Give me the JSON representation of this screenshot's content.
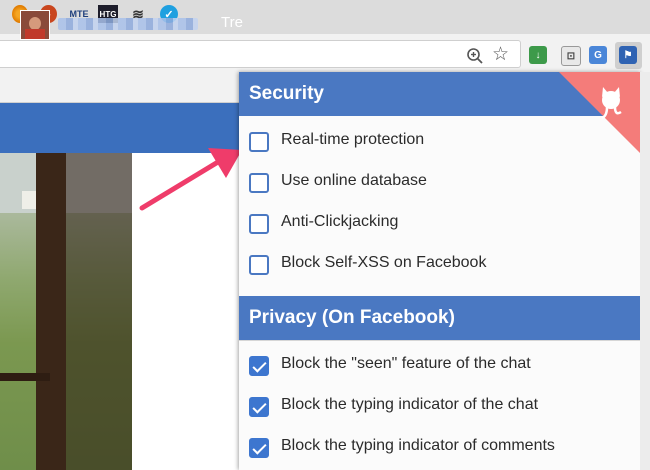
{
  "popup": {
    "security_header": "Security",
    "security_options": [
      {
        "label": "Real-time protection",
        "checked": false
      },
      {
        "label": "Use online database",
        "checked": false
      },
      {
        "label": "Anti-Clickjacking",
        "checked": false
      },
      {
        "label": "Block Self-XSS on Facebook",
        "checked": false
      }
    ],
    "privacy_header": "Privacy (On Facebook)",
    "privacy_options": [
      {
        "label": "Block the \"seen\" feature of the chat",
        "checked": true
      },
      {
        "label": "Block the typing indicator of the chat",
        "checked": true
      },
      {
        "label": "Block the typing indicator of comments",
        "checked": true
      }
    ]
  },
  "bookmarks": [
    "MTE",
    "HTG"
  ],
  "facebook": {
    "partial_nav_text": "Tre"
  },
  "colors": {
    "header_blue": "#4a78c2",
    "facebook_blue": "#3b6fbd",
    "checkbox_blue": "#3d76cf",
    "arrow_pink": "#ef3c6a"
  }
}
